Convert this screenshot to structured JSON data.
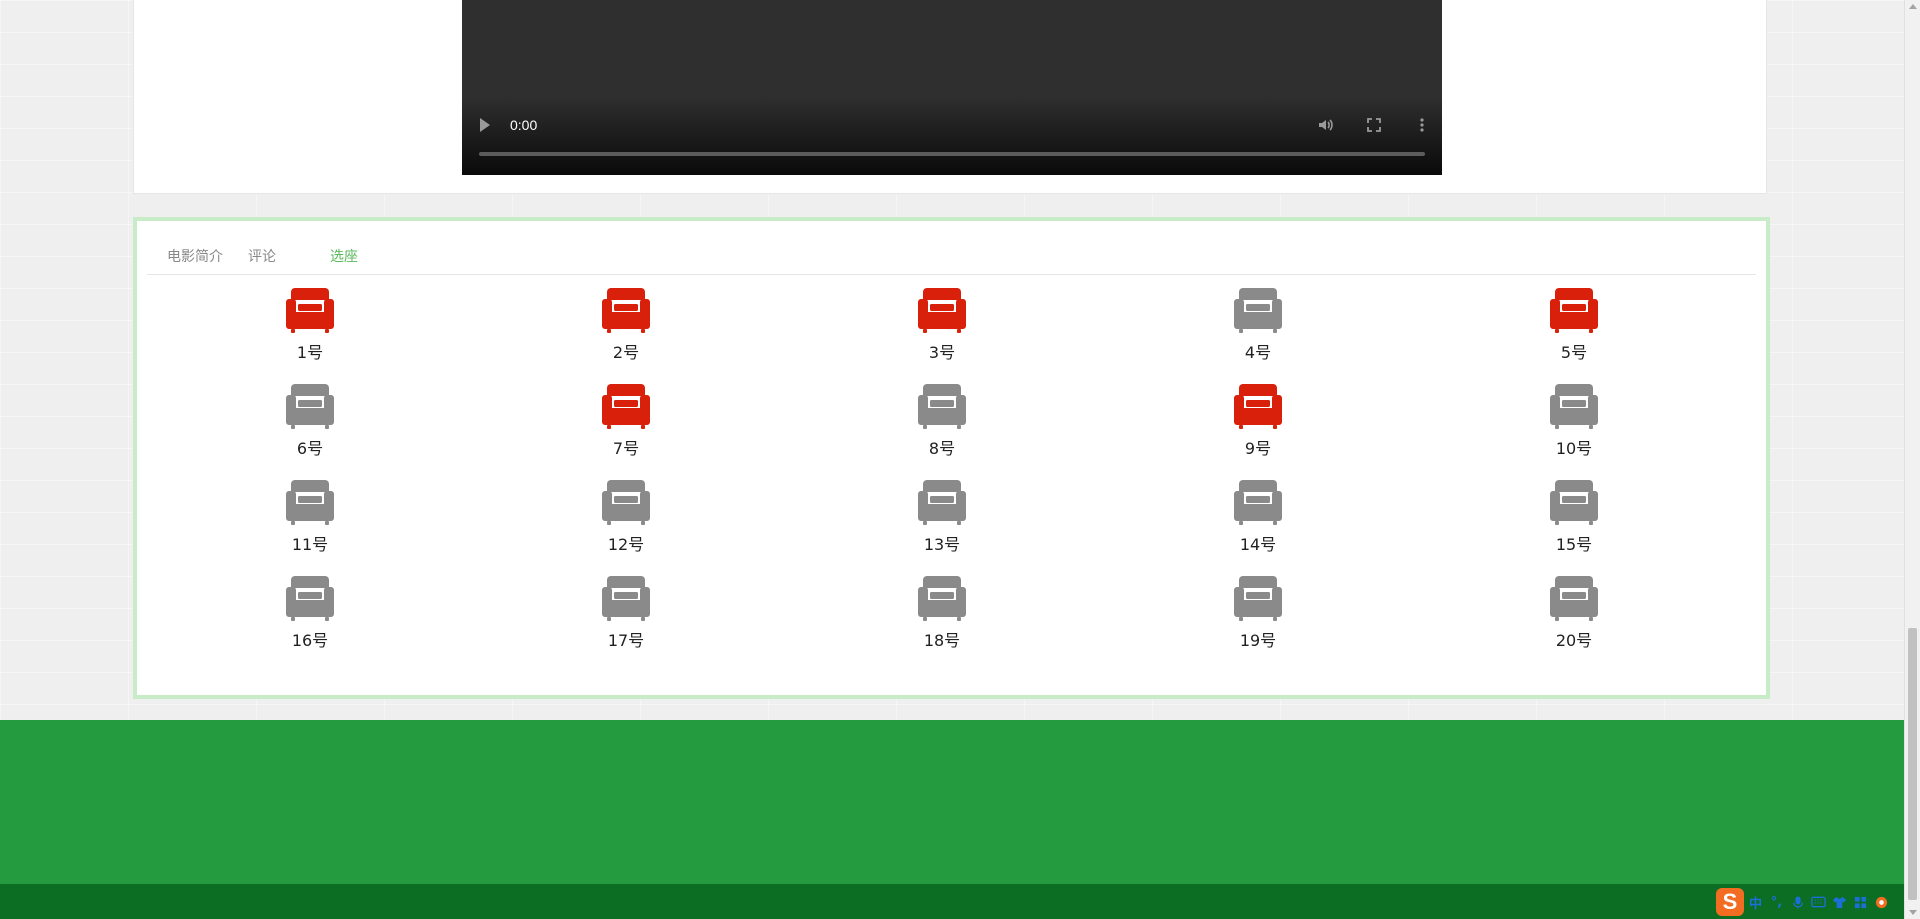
{
  "video": {
    "current_time": "0:00",
    "progress": 0
  },
  "tabs": [
    {
      "label": "电影简介",
      "active": false
    },
    {
      "label": "评论",
      "active": false
    },
    {
      "label": "选座",
      "active": true
    }
  ],
  "seats": [
    {
      "label": "1号",
      "taken": true
    },
    {
      "label": "2号",
      "taken": true
    },
    {
      "label": "3号",
      "taken": true
    },
    {
      "label": "4号",
      "taken": false
    },
    {
      "label": "5号",
      "taken": true
    },
    {
      "label": "6号",
      "taken": false
    },
    {
      "label": "7号",
      "taken": true
    },
    {
      "label": "8号",
      "taken": false
    },
    {
      "label": "9号",
      "taken": true
    },
    {
      "label": "10号",
      "taken": false
    },
    {
      "label": "11号",
      "taken": false
    },
    {
      "label": "12号",
      "taken": false
    },
    {
      "label": "13号",
      "taken": false
    },
    {
      "label": "14号",
      "taken": false
    },
    {
      "label": "15号",
      "taken": false
    },
    {
      "label": "16号",
      "taken": false
    },
    {
      "label": "17号",
      "taken": false
    },
    {
      "label": "18号",
      "taken": false
    },
    {
      "label": "19号",
      "taken": false
    },
    {
      "label": "20号",
      "taken": false
    }
  ],
  "colors": {
    "seat_taken": "#d9200b",
    "seat_free": "#8a8a8a",
    "tab_active": "#5cb85c",
    "footer": "#259b40",
    "footer_bottom": "#0b6e22",
    "panel_border": "#c8ebc8"
  },
  "ime": {
    "logo": "S",
    "items": [
      "中",
      "°,",
      "mic-icon",
      "keyboard-icon",
      "shirt-icon",
      "grid-icon",
      "settings-icon"
    ],
    "lang_label": "中",
    "punct_label": "°,"
  },
  "icons": {
    "seat": "armchair-icon",
    "play": "play-icon",
    "mute": "volume-icon",
    "fullscreen": "fullscreen-icon",
    "more": "more-vertical-icon"
  }
}
